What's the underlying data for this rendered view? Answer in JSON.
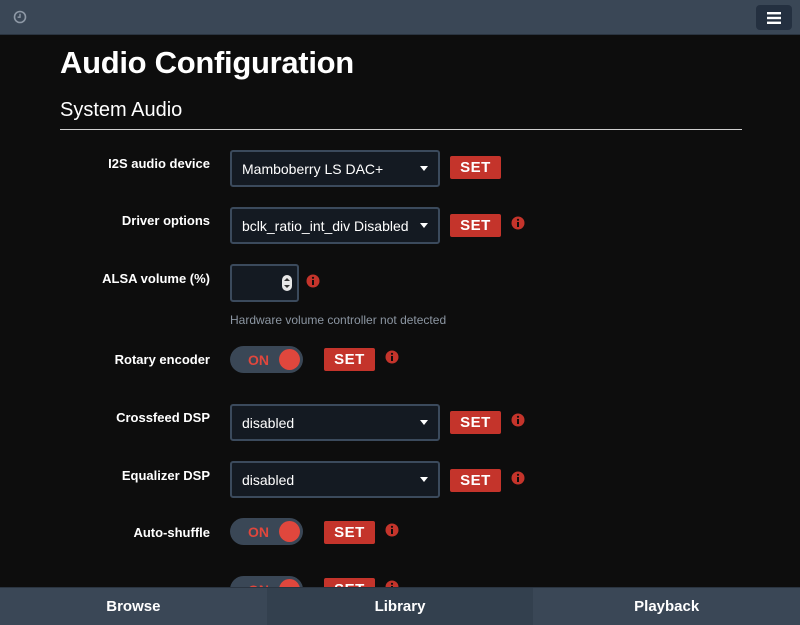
{
  "header": {
    "clock_icon": "clock-icon",
    "menu_icon": "hamburger-menu-icon"
  },
  "page": {
    "title": "Audio Configuration",
    "section": "System Audio"
  },
  "rows": {
    "i2s": {
      "label": "I2S audio device",
      "value": "Mamboberry LS DAC+",
      "set": "SET"
    },
    "driver": {
      "label": "Driver options",
      "value": "bclk_ratio_int_div Disabled",
      "set": "SET"
    },
    "alsa": {
      "label": "ALSA volume (%)",
      "value": "",
      "hint": "Hardware volume controller not detected"
    },
    "rotary": {
      "label": "Rotary encoder",
      "toggle": "ON",
      "set": "SET"
    },
    "crossfeed": {
      "label": "Crossfeed DSP",
      "value": "disabled",
      "set": "SET"
    },
    "equalizer": {
      "label": "Equalizer DSP",
      "value": "disabled",
      "set": "SET"
    },
    "autoshuffle": {
      "label": "Auto-shuffle",
      "toggle": "ON",
      "set": "SET"
    },
    "autoplay": {
      "label": "",
      "toggle": "ON",
      "set": "SET"
    }
  },
  "tabs": {
    "browse": "Browse",
    "library": "Library",
    "playback": "Playback"
  },
  "colors": {
    "accent": "#c4342b",
    "bar": "#3a4756",
    "background": "#0d0d0d"
  }
}
